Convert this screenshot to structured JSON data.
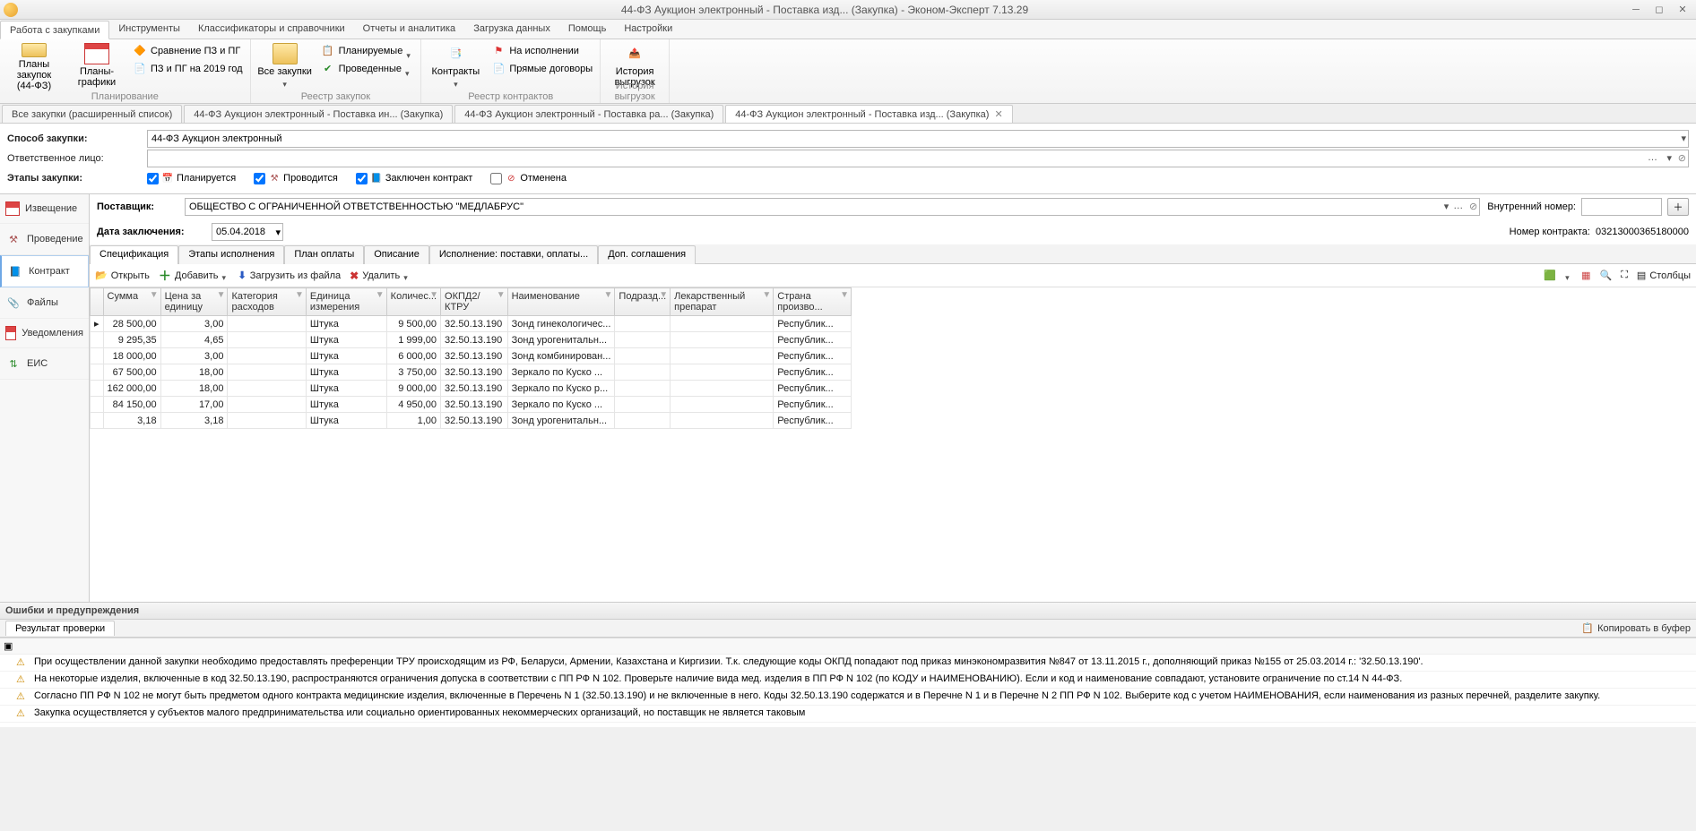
{
  "title": "44-ФЗ Аукцион электронный - Поставка изд... (Закупка) - Эконом-Эксперт 7.13.29",
  "ribbon_tabs": [
    "Работа с закупками",
    "Инструменты",
    "Классификаторы и справочники",
    "Отчеты и аналитика",
    "Загрузка данных",
    "Помощь",
    "Настройки"
  ],
  "ribbon": {
    "g1": {
      "label": "Планирование",
      "btns": {
        "plans": "Планы закупок\n(44-ФЗ)",
        "graphs": "Планы-графики",
        "cmp": "Сравнение ПЗ и ПГ",
        "pzpg": "ПЗ и ПГ на 2019 год"
      }
    },
    "g2": {
      "label": "Реестр закупок",
      "btns": {
        "all": "Все закупки",
        "planned": "Планируемые",
        "done": "Проведенные"
      }
    },
    "g3": {
      "label": "Реестр контрактов",
      "btns": {
        "contracts": "Контракты",
        "exec": "На исполнении",
        "direct": "Прямые договоры"
      }
    },
    "g4": {
      "label": "История выгрузок",
      "btns": {
        "hist": "История\nвыгрузок"
      }
    }
  },
  "doc_tabs": [
    {
      "label": "Все закупки (расширенный список)"
    },
    {
      "label": "44-ФЗ Аукцион электронный - Поставка  ин... (Закупка)"
    },
    {
      "label": "44-ФЗ Аукцион электронный - Поставка  ра... (Закупка)"
    },
    {
      "label": "44-ФЗ Аукцион электронный - Поставка изд... (Закупка)",
      "active": true,
      "closable": true
    }
  ],
  "form": {
    "method_label": "Способ закупки:",
    "method_value": "44-ФЗ Аукцион электронный",
    "resp_label": "Ответственное лицо:",
    "resp_value": "",
    "stages_label": "Этапы закупки:",
    "st_plan": "Планируется",
    "st_run": "Проводится",
    "st_contract": "Заключен контракт",
    "st_cancel": "Отменена"
  },
  "side": {
    "notice": "Извещение",
    "conduct": "Проведение",
    "contract": "Контракт",
    "files": "Файлы",
    "notif": "Уведомления",
    "eis": "ЕИС"
  },
  "supplier": {
    "label": "Поставщик:",
    "value": "ОБЩЕСТВО С ОГРАНИЧЕННОЙ ОТВЕТСТВЕННОСТЬЮ \"МЕДЛАБРУС\"",
    "date_label": "Дата заключения:",
    "date_value": "05.04.2018",
    "intnum_label": "Внутренний номер:",
    "intnum_value": "",
    "contractnum_label": "Номер контракта:",
    "contractnum_value": "03213000365180000"
  },
  "inner_tabs": [
    "Спецификация",
    "Этапы исполнения",
    "План оплаты",
    "Описание",
    "Исполнение: поставки, оплаты...",
    "Доп. соглашения"
  ],
  "toolbar": {
    "open": "Открыть",
    "add": "Добавить",
    "load": "Загрузить из файла",
    "del": "Удалить",
    "cols": "Столбцы"
  },
  "columns": [
    "Сумма",
    "Цена за единицу",
    "Категория расходов",
    "Единица измерения",
    "Количес...",
    "ОКПД2/КТРУ",
    "Наименование",
    "Подразд...",
    "Лекарственный препарат",
    "Страна произво..."
  ],
  "rows": [
    {
      "sum": "28 500,00",
      "price": "3,00",
      "cat": "",
      "unit": "Штука",
      "qty": "9 500,00",
      "okpd": "32.50.13.190",
      "name": "Зонд гинекологичес...",
      "dept": "",
      "med": "",
      "country": "Республик..."
    },
    {
      "sum": "9 295,35",
      "price": "4,65",
      "cat": "",
      "unit": "Штука",
      "qty": "1 999,00",
      "okpd": "32.50.13.190",
      "name": "Зонд урогенитальн...",
      "dept": "",
      "med": "",
      "country": "Республик..."
    },
    {
      "sum": "18 000,00",
      "price": "3,00",
      "cat": "",
      "unit": "Штука",
      "qty": "6 000,00",
      "okpd": "32.50.13.190",
      "name": "Зонд комбинирован...",
      "dept": "",
      "med": "",
      "country": "Республик..."
    },
    {
      "sum": "67 500,00",
      "price": "18,00",
      "cat": "",
      "unit": "Штука",
      "qty": "3 750,00",
      "okpd": "32.50.13.190",
      "name": "Зеркало  по Куско ...",
      "dept": "",
      "med": "",
      "country": "Республик..."
    },
    {
      "sum": "162 000,00",
      "price": "18,00",
      "cat": "",
      "unit": "Штука",
      "qty": "9 000,00",
      "okpd": "32.50.13.190",
      "name": "Зеркало  по Куско р...",
      "dept": "",
      "med": "",
      "country": "Республик..."
    },
    {
      "sum": "84 150,00",
      "price": "17,00",
      "cat": "",
      "unit": "Штука",
      "qty": "4 950,00",
      "okpd": "32.50.13.190",
      "name": "Зеркало  по Куско ...",
      "dept": "",
      "med": "",
      "country": "Республик..."
    },
    {
      "sum": "3,18",
      "price": "3,18",
      "cat": "",
      "unit": "Штука",
      "qty": "1,00",
      "okpd": "32.50.13.190",
      "name": "Зонд урогенитальн...",
      "dept": "",
      "med": "",
      "country": "Республик..."
    }
  ],
  "err_header": "Ошибки и предупреждения",
  "res_tab": "Результат проверки",
  "copy": "Копировать в буфер",
  "messages": [
    "При осуществлении данной закупки необходимо предоставлять преференции ТРУ происходящим из РФ, Беларуси, Армении, Казахстана и Киргизии. Т.к. следующие коды ОКПД попадают под приказ минэкономразвития №847 от 13.11.2015 г., дополняющий приказ №155 от 25.03.2014 г.: '32.50.13.190'.",
    "На некоторые изделия, включенные в код 32.50.13.190, распространяются ограничения допуска в соответствии с ПП РФ N 102. Проверьте наличие вида мед. изделия в ПП РФ N 102 (по КОДУ и НАИМЕНОВАНИЮ). Если и код и наименование совпадают, установите ограничение по ст.14 N 44-ФЗ.",
    "Согласно ПП РФ N 102 не могут быть предметом одного контракта медицинские изделия, включенные в Перечень N 1 (32.50.13.190) и не включенные в него. Коды 32.50.13.190 содержатся и в Перечне N 1 и в Перечне N 2 ПП РФ N 102. Выберите код с учетом НАИМЕНОВАНИЯ, если наименования из разных перечней, разделите закупку.",
    "Закупка осуществляется у субъектов малого предпринимательства или социально ориентированных некоммерческих организаций, но поставщик не является таковым"
  ]
}
